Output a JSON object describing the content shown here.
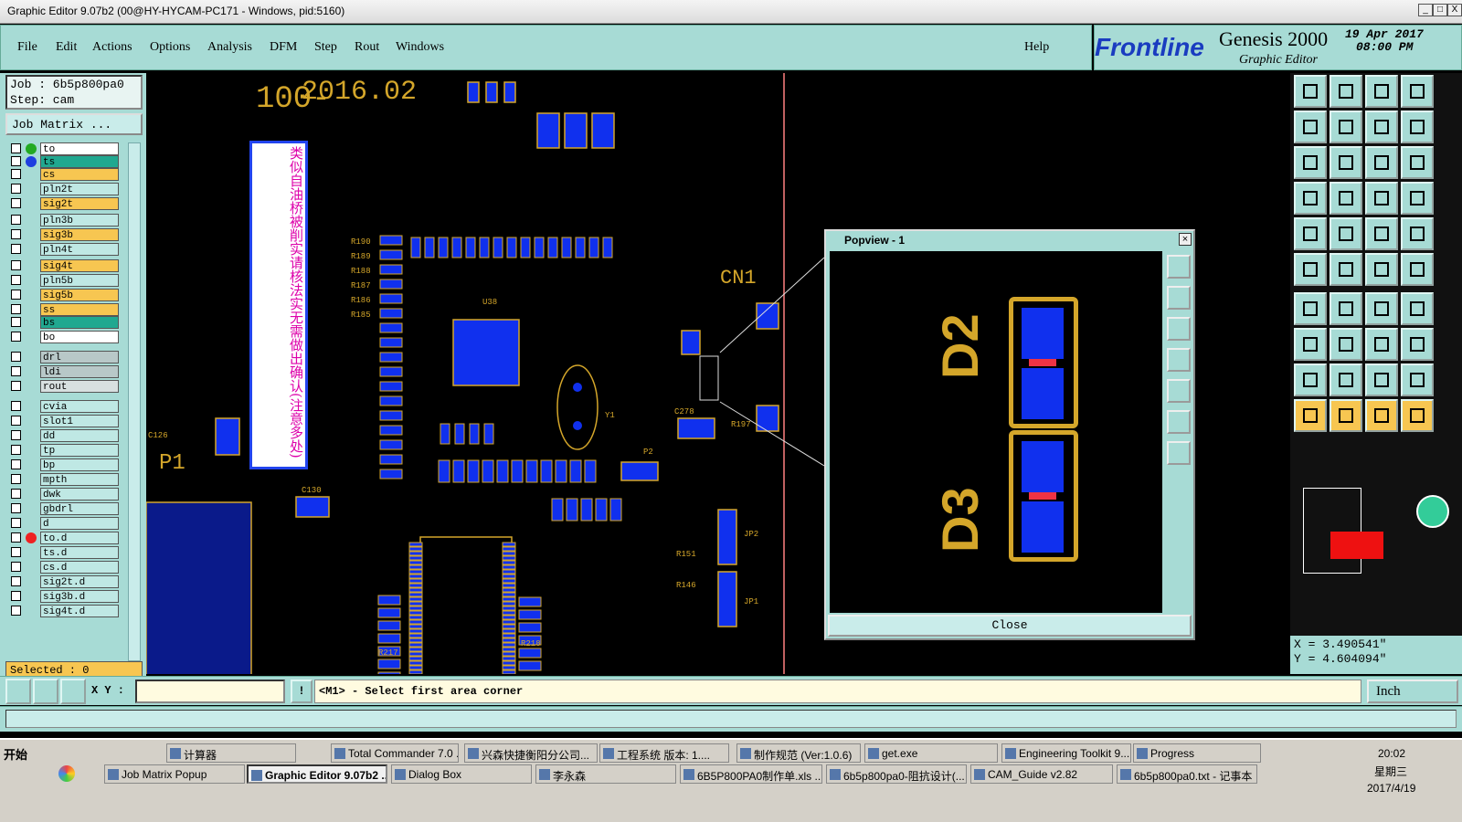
{
  "window": {
    "title": "Graphic Editor 9.07b2 (00@HY-HYCAM-PC171 - Windows, pid:5160)",
    "min": "_",
    "max": "□",
    "close": "X"
  },
  "menu": {
    "items": [
      "File",
      "Edit",
      "Actions",
      "Options",
      "Analysis",
      "DFM",
      "Step",
      "Rout",
      "Windows"
    ],
    "help": "Help"
  },
  "brand": {
    "logo": "Frontline",
    "product": "Genesis 2000",
    "sub": "Graphic Editor",
    "date": "19 Apr 2017",
    "time": "08:00 PM"
  },
  "job": {
    "job_line": "Job : 6b5p800pa0",
    "step_line": "Step: cam",
    "matrix_button": "Job Matrix ..."
  },
  "layers": [
    {
      "name": "to",
      "bg": "#ffffff",
      "dot": "#22aa22"
    },
    {
      "name": "ts",
      "bg": "#20a890",
      "dot": "#1f3fe0"
    },
    {
      "name": "cs",
      "bg": "#f7c651",
      "dot": ""
    },
    {
      "name": "pln2t",
      "bg": "#bfe8e4",
      "dot": ""
    },
    {
      "name": "sig2t",
      "bg": "#f7c651",
      "dot": ""
    },
    {
      "name": "pln3b",
      "bg": "#bfe8e4",
      "dot": ""
    },
    {
      "name": "sig3b",
      "bg": "#f7c651",
      "dot": ""
    },
    {
      "name": "pln4t",
      "bg": "#bfe8e4",
      "dot": ""
    },
    {
      "name": "sig4t",
      "bg": "#f7c651",
      "dot": ""
    },
    {
      "name": "pln5b",
      "bg": "#bfe8e4",
      "dot": ""
    },
    {
      "name": "sig5b",
      "bg": "#f7c651",
      "dot": ""
    },
    {
      "name": "ss",
      "bg": "#f7c651",
      "dot": ""
    },
    {
      "name": "bs",
      "bg": "#20a890",
      "dot": ""
    },
    {
      "name": "bo",
      "bg": "#ffffff",
      "dot": ""
    },
    {
      "name": "drl",
      "bg": "#b8c8c8",
      "dot": ""
    },
    {
      "name": "ldi",
      "bg": "#b8c8c8",
      "dot": ""
    },
    {
      "name": "rout",
      "bg": "#d8e0e0",
      "dot": ""
    },
    {
      "name": "cvia",
      "bg": "#bfe8e4",
      "dot": ""
    },
    {
      "name": "slot1",
      "bg": "#bfe8e4",
      "dot": ""
    },
    {
      "name": "dd",
      "bg": "#bfe8e4",
      "dot": ""
    },
    {
      "name": "tp",
      "bg": "#bfe8e4",
      "dot": ""
    },
    {
      "name": "bp",
      "bg": "#bfe8e4",
      "dot": ""
    },
    {
      "name": "mpth",
      "bg": "#bfe8e4",
      "dot": ""
    },
    {
      "name": "dwk",
      "bg": "#bfe8e4",
      "dot": ""
    },
    {
      "name": "gbdrl",
      "bg": "#bfe8e4",
      "dot": ""
    },
    {
      "name": "d",
      "bg": "#bfe8e4",
      "dot": ""
    },
    {
      "name": "to.d",
      "bg": "#bfe8e4",
      "dot": "#ee2222"
    },
    {
      "name": "ts.d",
      "bg": "#bfe8e4",
      "dot": ""
    },
    {
      "name": "cs.d",
      "bg": "#bfe8e4",
      "dot": ""
    },
    {
      "name": "sig2t.d",
      "bg": "#bfe8e4",
      "dot": ""
    },
    {
      "name": "sig3b.d",
      "bg": "#bfe8e4",
      "dot": ""
    },
    {
      "name": "sig4t.d",
      "bg": "#bfe8e4",
      "dot": ""
    }
  ],
  "selected": "Selected : 0",
  "note_text": "类似自油桥被削实请核法实无需做出确认(注意多处)",
  "popview": {
    "title": "Popview - 1",
    "close_label": "Close",
    "labels": [
      "D2",
      "D3"
    ]
  },
  "coords": {
    "x": "X = 3.490541\"",
    "y": "Y = 4.604094\""
  },
  "cmd": {
    "xy_label": "X Y :",
    "xy_value": "",
    "prompt": "<M1> - Select first area corner",
    "units": "Inch"
  },
  "taskbar": {
    "start": "开始",
    "row1": [
      "计算器",
      "Total Commander 7.0 ...",
      "兴森快捷衡阳分公司...",
      "工程系统 版本: 1....",
      "制作规范 (Ver:1.0.6)",
      "get.exe",
      "Engineering Toolkit 9....",
      "Progress"
    ],
    "row2": [
      "Job Matrix Popup",
      "Graphic Editor 9.07b2 ...",
      "Dialog Box",
      "李永森",
      "6B5P800PA0制作单.xls ...",
      "6b5p800pa0-阻抗设计(...",
      "CAM_Guide v2.82",
      "6b5p800pa0.txt - 记事本"
    ],
    "clock_time": "20:02",
    "clock_day": "星期三",
    "clock_date": "2017/4/19"
  },
  "pcb_labels": [
    "P1",
    "CN1",
    "C126",
    "R190",
    "R189",
    "R188",
    "R187",
    "R186",
    "R185",
    "U38",
    "Y1",
    "P2",
    "JP2",
    "JP1",
    "R197",
    "C278",
    "R151",
    "R146",
    "C130",
    "R218",
    "R217"
  ]
}
